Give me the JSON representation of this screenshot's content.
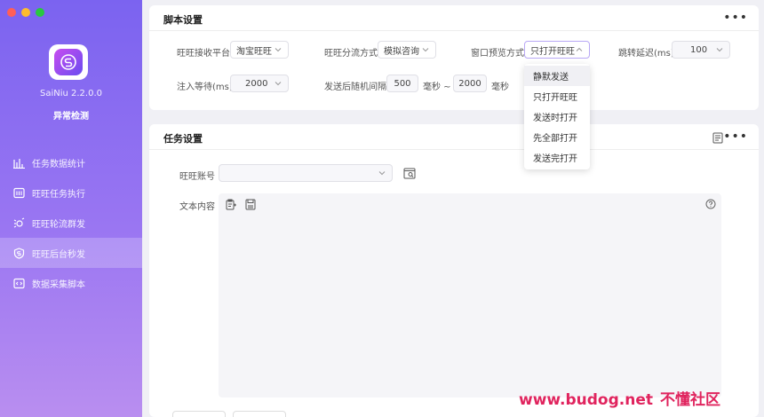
{
  "app": {
    "version": "SaiNiu 2.2.0.0",
    "status": "异常检测"
  },
  "sidebar": {
    "items": [
      {
        "label": "任务数据统计",
        "icon": "bar-chart-icon"
      },
      {
        "label": "旺旺任务执行",
        "icon": "task-list-icon"
      },
      {
        "label": "旺旺轮流群发",
        "icon": "broadcast-icon"
      },
      {
        "label": "旺旺后台秒发",
        "icon": "shield-icon",
        "active": true
      },
      {
        "label": "数据采集脚本",
        "icon": "code-icon"
      }
    ]
  },
  "script_settings": {
    "title": "脚本设置",
    "platform_label": "旺旺接收平台",
    "platform_value": "淘宝旺旺",
    "split_label": "旺旺分流方式",
    "split_value": "模拟咨询",
    "preview_label": "窗口预览方式",
    "preview_value": "只打开旺旺",
    "jump_label": "跳转延迟(ms)",
    "jump_value": "100",
    "inject_label": "注入等待(ms)",
    "inject_value": "2000",
    "interval_label": "发送后随机间隔",
    "interval_min": "500",
    "unit1": "毫秒 ~",
    "interval_max": "2000",
    "unit2": "毫秒"
  },
  "preview_dropdown": {
    "options": [
      "静默发送",
      "只打开旺旺",
      "发送时打开",
      "先全部打开",
      "发送完打开"
    ]
  },
  "task_settings": {
    "title": "任务设置",
    "account_label": "旺旺账号",
    "account_value": "",
    "text_label": "文本内容"
  },
  "watermark": {
    "url": "www.budog.net",
    "text": "不懂社区"
  },
  "colors": {
    "sidebar_top": "#7b63f0",
    "sidebar_bottom": "#b98ef0",
    "watermark": "#e0245e"
  }
}
